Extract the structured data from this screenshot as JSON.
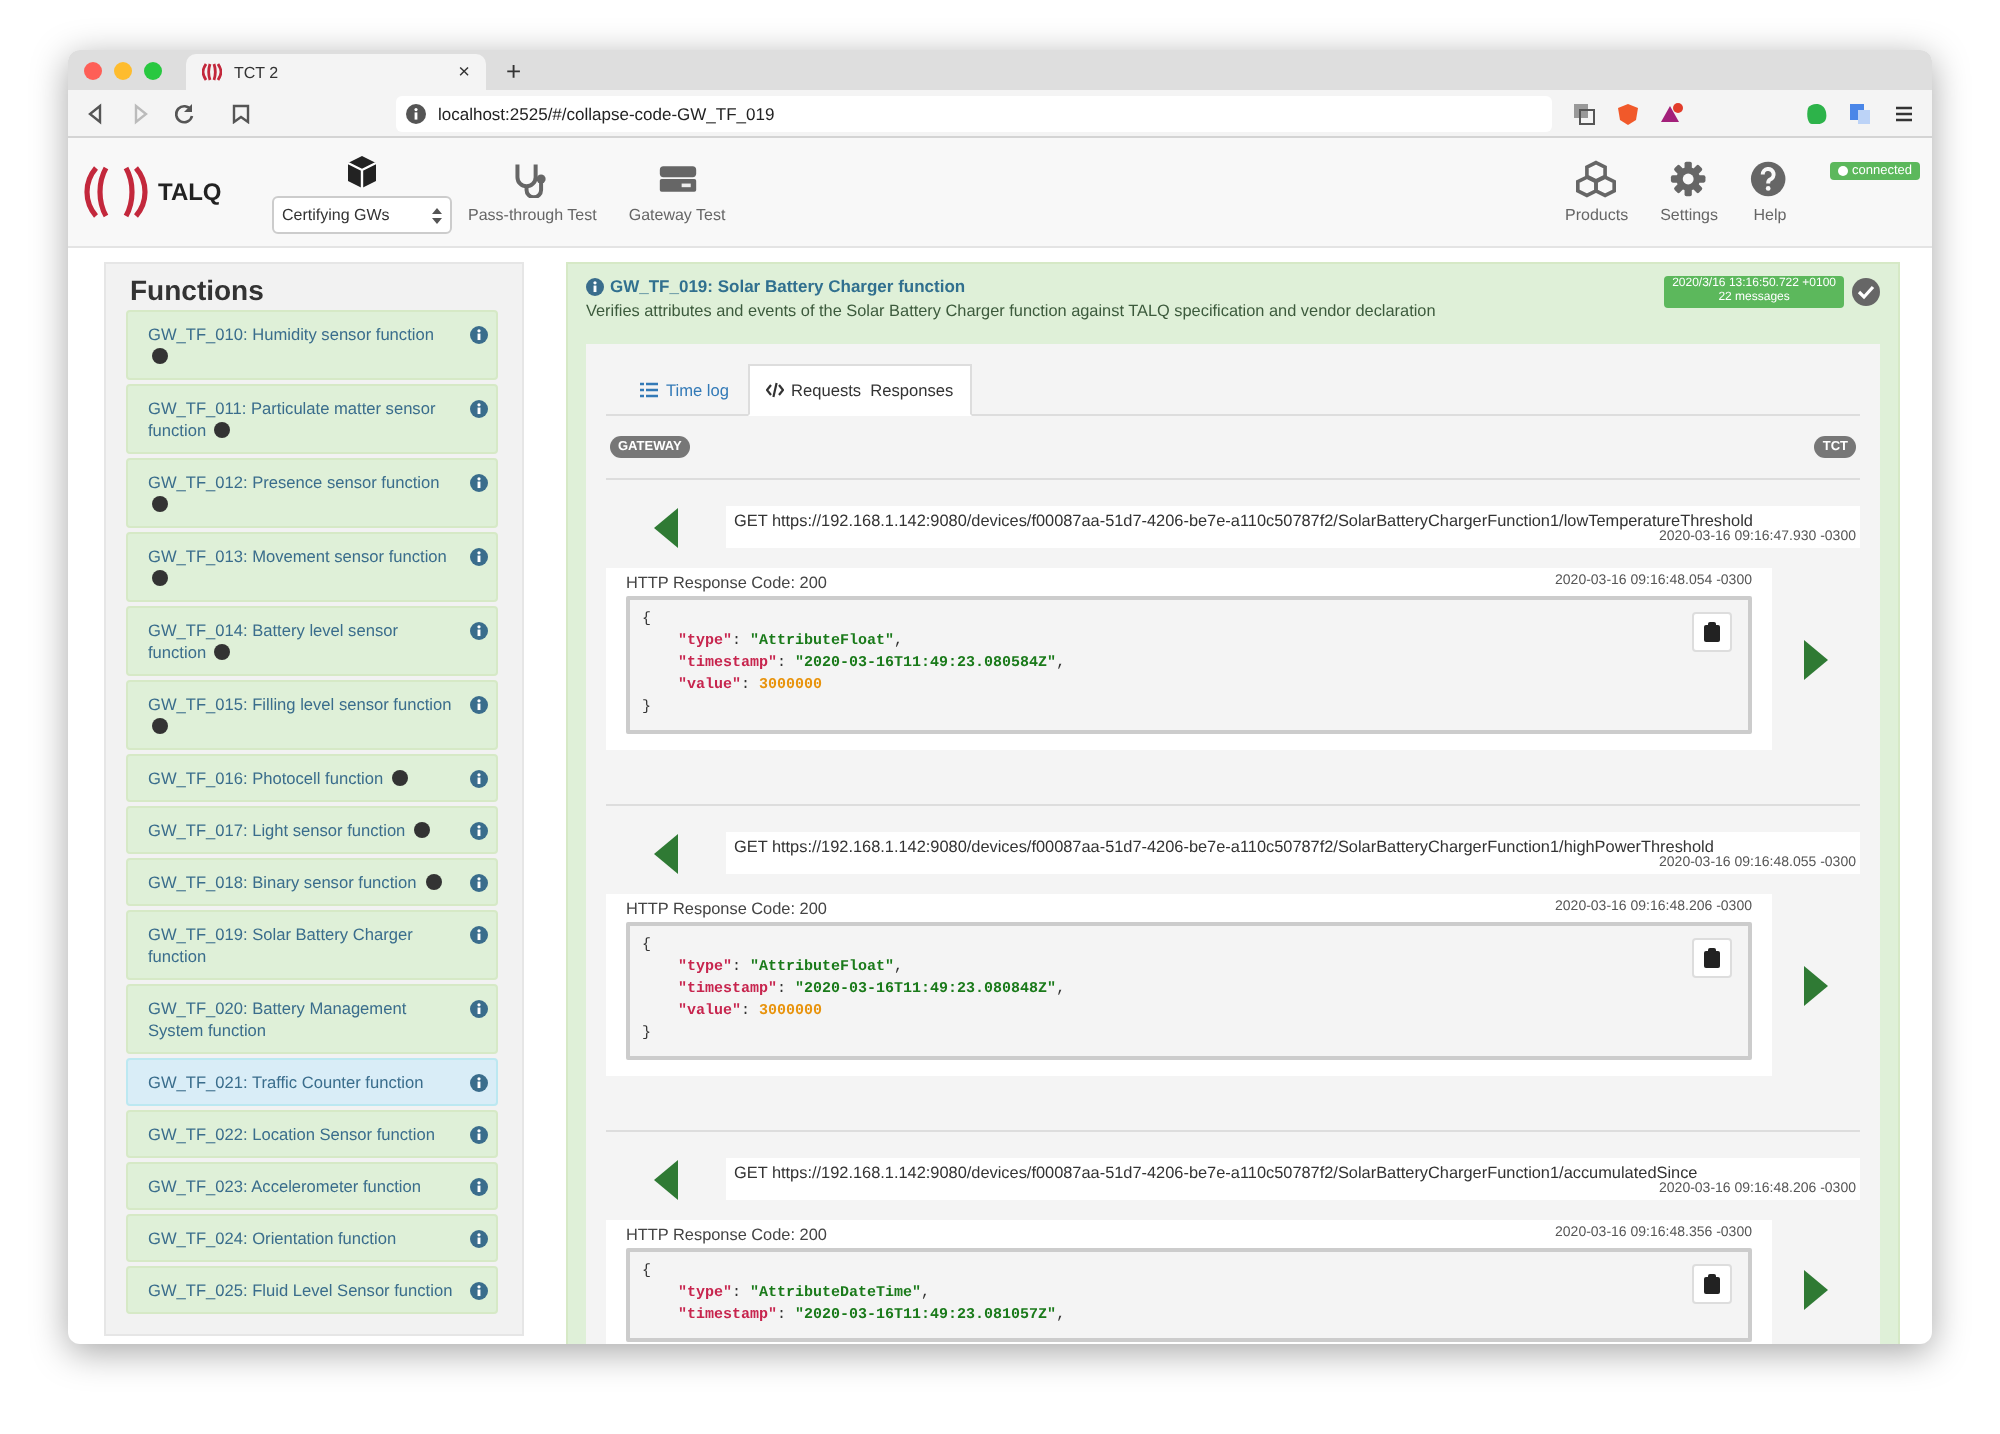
{
  "browser": {
    "tab_title": "TCT 2",
    "tab_close": "×",
    "new_tab": "+",
    "url": "localhost:2525/#/collapse-code-GW_TF_019"
  },
  "header": {
    "logo": "TALQ",
    "mode_select": "Certifying GWs",
    "nav": [
      {
        "label": "Pass-through Test",
        "kind": "stethoscope"
      },
      {
        "label": "Gateway Test",
        "kind": "server"
      }
    ],
    "right_nav": [
      {
        "label": "Products",
        "kind": "cubes"
      },
      {
        "label": "Settings",
        "kind": "gear"
      },
      {
        "label": "Help",
        "kind": "help"
      }
    ],
    "status": "connected"
  },
  "sidebar": {
    "title": "Functions",
    "items": [
      {
        "label": "GW_TF_010: Humidity sensor function",
        "badge": true,
        "selected": false
      },
      {
        "label": "GW_TF_011: Particulate matter sensor function",
        "badge": true,
        "selected": false
      },
      {
        "label": "GW_TF_012: Presence sensor function",
        "badge": true,
        "selected": false
      },
      {
        "label": "GW_TF_013: Movement sensor function",
        "badge": true,
        "selected": false
      },
      {
        "label": "GW_TF_014: Battery level sensor function",
        "badge": true,
        "selected": false
      },
      {
        "label": "GW_TF_015: Filling level sensor function",
        "badge": true,
        "selected": false
      },
      {
        "label": "GW_TF_016: Photocell function",
        "badge": true,
        "selected": false
      },
      {
        "label": "GW_TF_017: Light sensor function",
        "badge": true,
        "selected": false
      },
      {
        "label": "GW_TF_018: Binary sensor function",
        "badge": true,
        "selected": false
      },
      {
        "label": "GW_TF_019: Solar Battery Charger function",
        "badge": false,
        "selected": false
      },
      {
        "label": "GW_TF_020: Battery Management System function",
        "badge": false,
        "selected": false
      },
      {
        "label": "GW_TF_021: Traffic Counter function",
        "badge": false,
        "selected": true
      },
      {
        "label": "GW_TF_022: Location Sensor function",
        "badge": false,
        "selected": false
      },
      {
        "label": "GW_TF_023: Accelerometer function",
        "badge": false,
        "selected": false
      },
      {
        "label": "GW_TF_024: Orientation function",
        "badge": false,
        "selected": false
      },
      {
        "label": "GW_TF_025: Fluid Level Sensor function",
        "badge": false,
        "selected": false
      }
    ]
  },
  "main": {
    "title": "GW_TF_019: Solar Battery Charger function",
    "description": "Verifies attributes and events of the Solar Battery Charger function against TALQ specification and vendor declaration",
    "timestamp": "2020/3/16 13:16:50.722 +0100",
    "message_count": "22 messages",
    "tabs": [
      {
        "label": "Time log",
        "kind": "list",
        "selected": false
      },
      {
        "label": "Requests  Responses",
        "kind": "code",
        "selected": true
      }
    ],
    "lanes": {
      "left": "GATEWAY",
      "right": "TCT"
    },
    "messages": [
      {
        "request": {
          "line": "GET https://192.168.1.142:9080/devices/f00087aa-51d7-4206-be7e-a110c50787f2/SolarBatteryChargerFunction1/lowTemperatureThreshold",
          "time": "2020-03-16 09:16:47.930 -0300"
        },
        "response": {
          "status": "HTTP Response Code: 200",
          "time": "2020-03-16 09:16:48.054 -0300",
          "lines": [
            {
              "kind": "brace",
              "text": "{"
            },
            {
              "kind": "string",
              "key": "\"type\"",
              "sep": ": ",
              "value": "\"AttributeFloat\"",
              "end": ","
            },
            {
              "kind": "string",
              "key": "\"timestamp\"",
              "sep": ": ",
              "value": "\"2020-03-16T11:49:23.080584Z\"",
              "end": ","
            },
            {
              "kind": "number",
              "key": "\"value\"",
              "sep": ": ",
              "value": "3000000"
            },
            {
              "kind": "brace",
              "text": "}"
            }
          ]
        }
      },
      {
        "request": {
          "line": "GET https://192.168.1.142:9080/devices/f00087aa-51d7-4206-be7e-a110c50787f2/SolarBatteryChargerFunction1/highPowerThreshold",
          "time": "2020-03-16 09:16:48.055 -0300"
        },
        "response": {
          "status": "HTTP Response Code: 200",
          "time": "2020-03-16 09:16:48.206 -0300",
          "lines": [
            {
              "kind": "brace",
              "text": "{"
            },
            {
              "kind": "string",
              "key": "\"type\"",
              "sep": ": ",
              "value": "\"AttributeFloat\"",
              "end": ","
            },
            {
              "kind": "string",
              "key": "\"timestamp\"",
              "sep": ": ",
              "value": "\"2020-03-16T11:49:23.080848Z\"",
              "end": ","
            },
            {
              "kind": "number",
              "key": "\"value\"",
              "sep": ": ",
              "value": "3000000"
            },
            {
              "kind": "brace",
              "text": "}"
            }
          ]
        }
      },
      {
        "request": {
          "line": "GET https://192.168.1.142:9080/devices/f00087aa-51d7-4206-be7e-a110c50787f2/SolarBatteryChargerFunction1/accumulatedSince",
          "time": "2020-03-16 09:16:48.206 -0300"
        },
        "response": {
          "status": "HTTP Response Code: 200",
          "time": "2020-03-16 09:16:48.356 -0300",
          "lines": [
            {
              "kind": "brace",
              "text": "{"
            },
            {
              "kind": "string",
              "key": "\"type\"",
              "sep": ": ",
              "value": "\"AttributeDateTime\"",
              "end": ","
            },
            {
              "kind": "string",
              "key": "\"timestamp\"",
              "sep": ": ",
              "value": "\"2020-03-16T11:49:23.081057Z\"",
              "end": ","
            }
          ]
        }
      }
    ]
  }
}
